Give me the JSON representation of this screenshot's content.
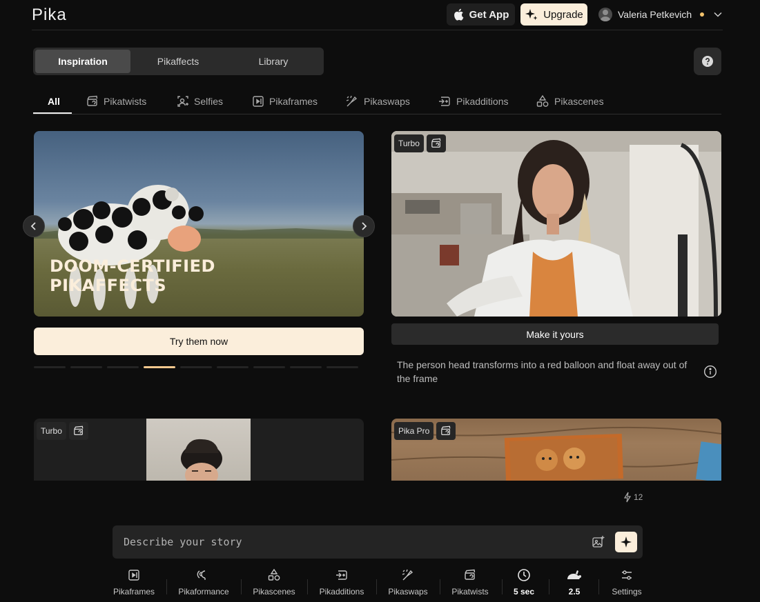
{
  "header": {
    "logo": "Pika",
    "get_app_label": "Get App",
    "upgrade_label": "Upgrade",
    "user_name": "Valeria Petkevich"
  },
  "main_tabs": [
    {
      "label": "Inspiration",
      "active": true
    },
    {
      "label": "Pikaffects",
      "active": false
    },
    {
      "label": "Library",
      "active": false
    }
  ],
  "categories": [
    {
      "label": "All",
      "icon": "none",
      "active": true
    },
    {
      "label": "Pikatwists",
      "icon": "clapper-twist-icon"
    },
    {
      "label": "Selfies",
      "icon": "selfie-icon"
    },
    {
      "label": "Pikaframes",
      "icon": "frames-icon"
    },
    {
      "label": "Pikaswaps",
      "icon": "swap-brush-icon"
    },
    {
      "label": "Pikadditions",
      "icon": "addition-icon"
    },
    {
      "label": "Pikascenes",
      "icon": "shapes-icon"
    }
  ],
  "hero": {
    "title_line1": "DOOM-CERTIFIED",
    "title_line2": "PIKAFFECTS",
    "cta_label": "Try them now",
    "slide_count": 9,
    "active_slide": 4
  },
  "featured": {
    "badge": "Turbo",
    "cta_label": "Make it yours",
    "description": "The person head transforms into a red balloon and float away out of the frame"
  },
  "card3": {
    "badge": "Turbo"
  },
  "card4": {
    "badge": "Pika Pro"
  },
  "credits": "12",
  "prompt": {
    "placeholder": "Describe your story"
  },
  "toolbar": [
    {
      "label": "Pikaframes",
      "icon": "frames-icon"
    },
    {
      "label": "Pikaformance",
      "icon": "voice-icon"
    },
    {
      "label": "Pikascenes",
      "icon": "shapes-icon"
    },
    {
      "label": "Pikadditions",
      "icon": "addition-icon"
    },
    {
      "label": "Pikaswaps",
      "icon": "swap-brush-icon"
    },
    {
      "label": "Pikatwists",
      "icon": "clapper-twist-icon"
    },
    {
      "label": "5 sec",
      "icon": "clock-icon"
    },
    {
      "label": "2.5",
      "icon": "rabbit-icon"
    },
    {
      "label": "Settings",
      "icon": "sliders-icon"
    }
  ],
  "colors": {
    "background": "#0d0d0d",
    "accent_cream": "#fbeedb",
    "active_dot": "#f3c88e",
    "panel": "#2b2b2b"
  }
}
